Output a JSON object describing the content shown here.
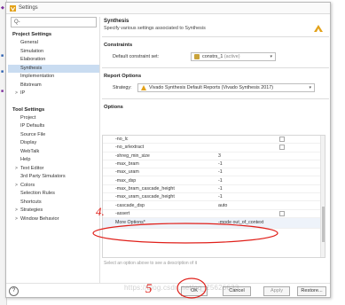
{
  "window": {
    "title": "Settings"
  },
  "search": {
    "placeholder": "Q-"
  },
  "nav": {
    "project_settings": {
      "heading": "Project Settings",
      "items": [
        {
          "label": "General",
          "chev": ""
        },
        {
          "label": "Simulation",
          "chev": ""
        },
        {
          "label": "Elaboration",
          "chev": ""
        },
        {
          "label": "Synthesis",
          "chev": "",
          "selected": true
        },
        {
          "label": "Implementation",
          "chev": ""
        },
        {
          "label": "Bitstream",
          "chev": ""
        },
        {
          "label": "IP",
          "chev": ">"
        }
      ]
    },
    "tool_settings": {
      "heading": "Tool Settings",
      "items": [
        {
          "label": "Project",
          "chev": ""
        },
        {
          "label": "IP Defaults",
          "chev": ""
        },
        {
          "label": "Source File",
          "chev": ""
        },
        {
          "label": "Display",
          "chev": ""
        },
        {
          "label": "WebTalk",
          "chev": ""
        },
        {
          "label": "Help",
          "chev": ""
        },
        {
          "label": "Text Editor",
          "chev": ">"
        },
        {
          "label": "3rd Party Simulators",
          "chev": ""
        },
        {
          "label": "Colors",
          "chev": ">"
        },
        {
          "label": "Selection Rules",
          "chev": ""
        },
        {
          "label": "Shortcuts",
          "chev": ""
        },
        {
          "label": "Strategies",
          "chev": ">"
        },
        {
          "label": "Window Behavior",
          "chev": ">"
        }
      ]
    }
  },
  "header": {
    "title": "Synthesis",
    "subtitle": "Specify various settings associated to Synthesis"
  },
  "constraints": {
    "section": "Constraints",
    "label": "Default constraint set:",
    "value": "constrs_1",
    "status": "(active)"
  },
  "report_options": {
    "section": "Report Options",
    "label": "Strategy:",
    "value": "Vivado Synthesis Default Reports (Vivado Synthesis 2017)"
  },
  "options": {
    "section": "Options",
    "rows": [
      {
        "name": "-no_lc",
        "value": "",
        "checkbox": true
      },
      {
        "name": "-no_srlextract",
        "value": "",
        "checkbox": true
      },
      {
        "name": "-shreg_min_size",
        "value": "3"
      },
      {
        "name": "-max_bram",
        "value": "-1"
      },
      {
        "name": "-max_uram",
        "value": "-1"
      },
      {
        "name": "-max_dsp",
        "value": "-1"
      },
      {
        "name": "-max_bram_cascade_height",
        "value": "-1"
      },
      {
        "name": "-max_uram_cascade_height",
        "value": "-1"
      },
      {
        "name": "-cascade_dsp",
        "value": "auto"
      },
      {
        "name": "-assert",
        "value": "",
        "checkbox": true
      },
      {
        "name": "More Options*",
        "value": "-mode out_of_context",
        "selected": true
      }
    ],
    "description": "Select an option above to see a description of it"
  },
  "footer": {
    "help": "?",
    "ok": "OK",
    "cancel": "Cancel",
    "apply": "Apply",
    "restore": "Restore..."
  },
  "annotations": {
    "step4": "4.",
    "step5": "5"
  },
  "watermark": "https://blog.csdn.net/qq_25626633",
  "colors": {
    "annotation": "#e0201a",
    "selection": "#c9dcf1",
    "accent": "#c9a33a"
  }
}
